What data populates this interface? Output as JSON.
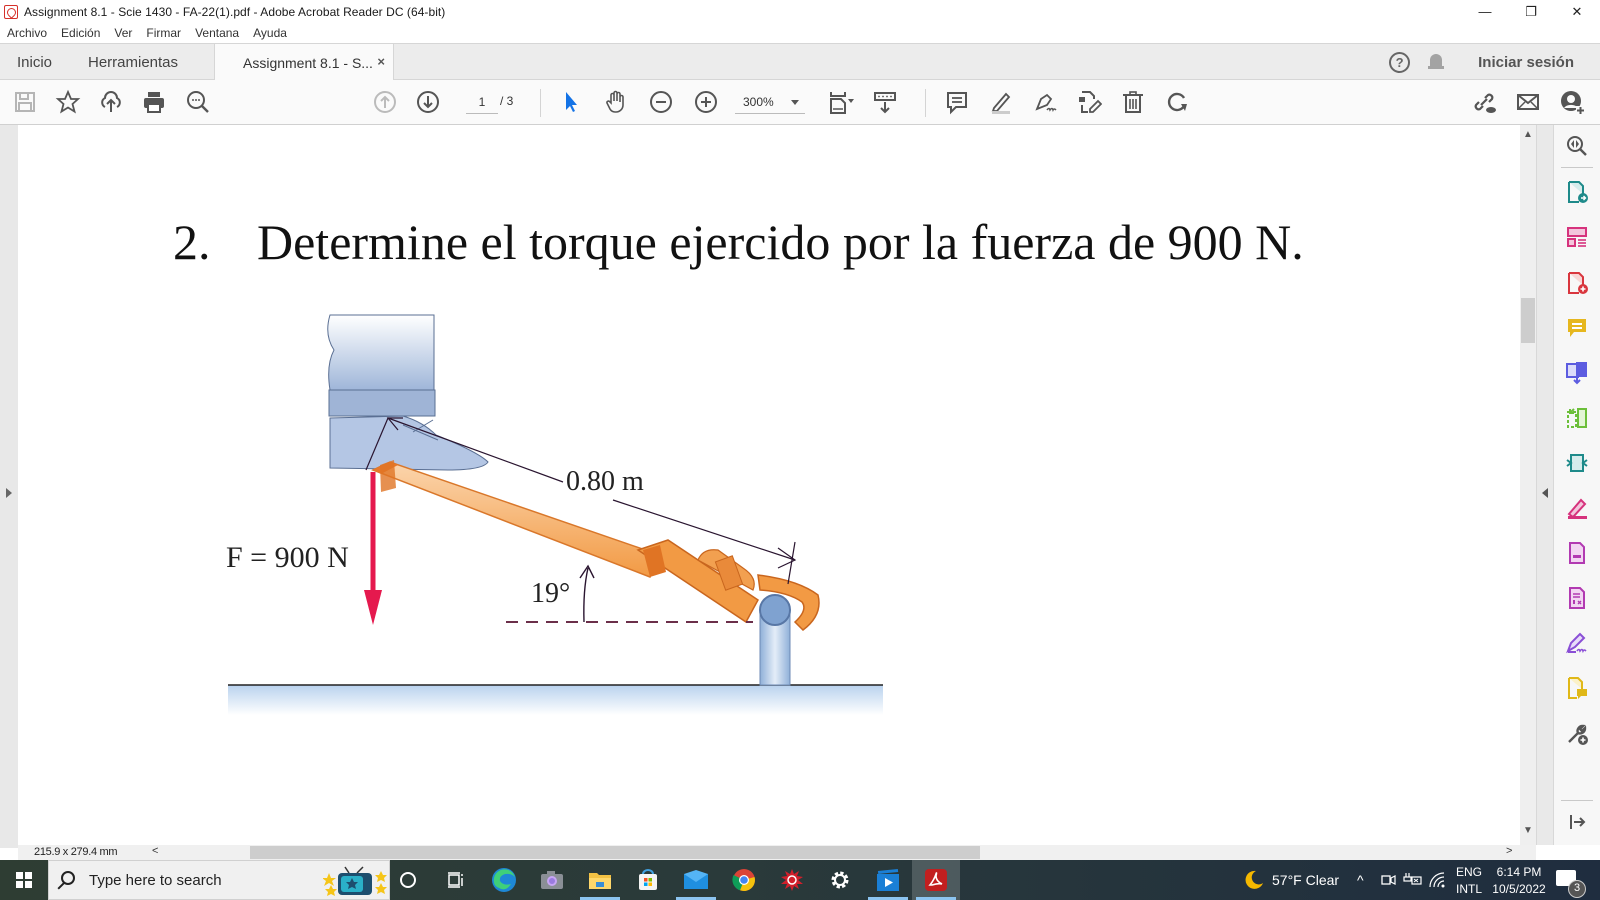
{
  "window": {
    "title": "Assignment 8.1 - Scie 1430 - FA-22(1).pdf - Adobe Acrobat Reader DC (64-bit)",
    "minimize": "—",
    "restore": "❐",
    "close": "✕"
  },
  "menu": [
    "Archivo",
    "Edición",
    "Ver",
    "Firmar",
    "Ventana",
    "Ayuda"
  ],
  "tabs": {
    "home": "Inicio",
    "tools": "Herramientas",
    "document": "Assignment 8.1 - S...",
    "close": "×"
  },
  "account": {
    "help": "?",
    "signin": "Iniciar sesión"
  },
  "toolbar": {
    "page_current": "1",
    "page_total": "/ 3",
    "zoom": "300%",
    "icons": [
      "save-icon",
      "bookmark-star-icon",
      "cloud-upload-icon",
      "print-icon",
      "search-document-icon",
      "previous-page-icon",
      "next-page-icon",
      "select-cursor-icon",
      "hand-pan-icon",
      "zoom-out-icon",
      "zoom-in-icon",
      "fit-page-icon",
      "scroll-mode-icon",
      "comment-icon",
      "highlight-icon",
      "sign-icon",
      "edit-text-icon",
      "delete-icon",
      "rotate-icon",
      "share-link-icon",
      "email-icon",
      "add-user-icon"
    ]
  },
  "document": {
    "problem_number": "2.",
    "problem_text": "Determine el torque ejercido por la fuerza de 900 N.",
    "figure": {
      "force_label": "F = 900 N",
      "length_label": "0.80 m",
      "angle_label": "19°"
    }
  },
  "right_tools": [
    "enhance-scan-icon",
    "export-pdf-icon",
    "organize-pages-icon",
    "create-pdf-icon",
    "comment-tool-icon",
    "combine-files-icon",
    "compress-icon",
    "edit-pdf-icon",
    "fill-sign-icon",
    "prepare-form-icon",
    "protect-icon",
    "request-signature-icon",
    "send-for-comments-icon",
    "more-tools-icon",
    "collapse-pane-icon"
  ],
  "status": {
    "page_size": "215.9 x 279.4 mm",
    "scroll_left": "<",
    "scroll_right": ">"
  },
  "taskbar": {
    "search_placeholder": "Type here to search",
    "apps": [
      "cortana-icon",
      "task-view-icon",
      "edge-icon",
      "camera-icon",
      "file-explorer-icon",
      "store-icon",
      "mail-icon",
      "chrome-icon",
      "spiral-app-icon",
      "settings-icon",
      "video-app-icon",
      "acrobat-icon"
    ],
    "weather": "57°F  Clear",
    "lang_top": "ENG",
    "lang_bottom": "INTL",
    "time": "6:14 PM",
    "date": "10/5/2022",
    "notifications": "3"
  },
  "colors": {
    "accent_blue": "#1473e6",
    "force_arrow": "#e5194e",
    "wrench_orange": "#f7a04a",
    "acrobat_red": "#c21f1f"
  }
}
